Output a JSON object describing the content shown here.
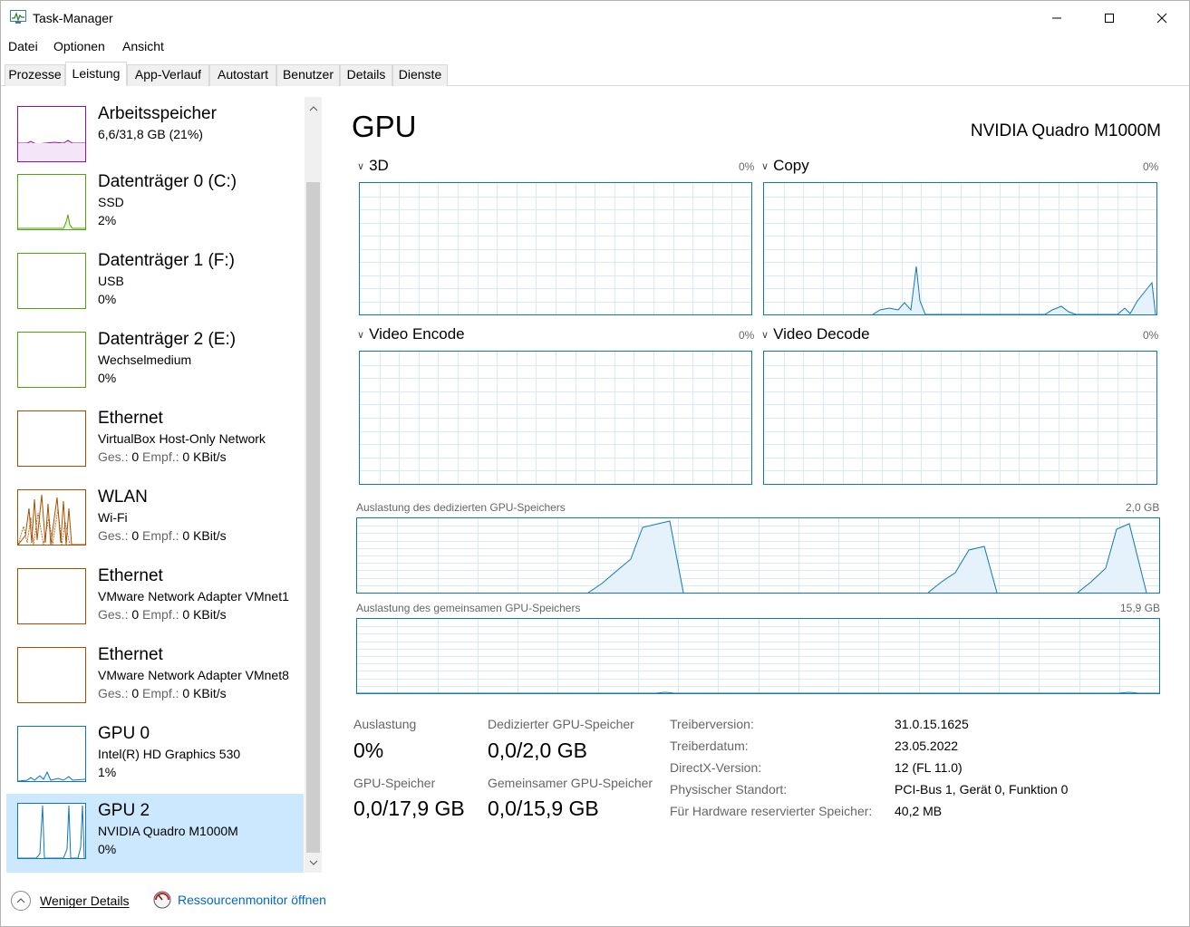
{
  "window": {
    "title": "Task-Manager",
    "minimize": "—",
    "maximize": "☐",
    "close": "✕"
  },
  "menu": [
    "Datei",
    "Optionen",
    "Ansicht"
  ],
  "tabs": [
    "Prozesse",
    "Leistung",
    "App-Verlauf",
    "Autostart",
    "Benutzer",
    "Details",
    "Dienste"
  ],
  "active_tab": "Leistung",
  "sidebar": {
    "items": [
      {
        "title": "Arbeitsspeicher",
        "sub": "6,6/31,8 GB (21%)",
        "val": "",
        "color": "#8b12ae"
      },
      {
        "title": "Datenträger 0 (C:)",
        "sub": "SSD",
        "val": "2%",
        "color": "#4da60c"
      },
      {
        "title": "Datenträger 1 (F:)",
        "sub": "USB",
        "val": "0%",
        "color": "#4da60c"
      },
      {
        "title": "Datenträger 2 (E:)",
        "sub": "Wechselmedium",
        "val": "0%",
        "color": "#4da60c"
      },
      {
        "title": "Ethernet",
        "sub": "VirtualBox Host-Only Network",
        "val_ges": "Ges.:",
        "val_ges_v": "0",
        "val_empf": "Empf.:",
        "val_empf_v": "0 KBit/s",
        "color": "#a74f01"
      },
      {
        "title": "WLAN",
        "sub": "Wi-Fi",
        "val_ges": "Ges.:",
        "val_ges_v": "0",
        "val_empf": "Empf.:",
        "val_empf_v": "0 KBit/s",
        "color": "#a74f01"
      },
      {
        "title": "Ethernet",
        "sub": "VMware Network Adapter VMnet1",
        "val_ges": "Ges.:",
        "val_ges_v": "0",
        "val_empf": "Empf.:",
        "val_empf_v": "0 KBit/s",
        "color": "#a74f01"
      },
      {
        "title": "Ethernet",
        "sub": "VMware Network Adapter VMnet8",
        "val_ges": "Ges.:",
        "val_ges_v": "0",
        "val_empf": "Empf.:",
        "val_empf_v": "0 KBit/s",
        "color": "#a74f01"
      },
      {
        "title": "GPU 0",
        "sub": "Intel(R) HD Graphics 530",
        "val": "1%",
        "color": "#1177bb"
      },
      {
        "title": "GPU 2",
        "sub": "NVIDIA Quadro M1000M",
        "val": "0%",
        "color": "#1177bb"
      }
    ]
  },
  "main": {
    "title": "GPU",
    "model": "NVIDIA Quadro M1000M",
    "engines": [
      {
        "label": "3D",
        "pct": "0%"
      },
      {
        "label": "Copy",
        "pct": "0%"
      },
      {
        "label": "Video Encode",
        "pct": "0%"
      },
      {
        "label": "Video Decode",
        "pct": "0%"
      }
    ],
    "dedicated_label": "Auslastung des dedizierten GPU-Speichers",
    "dedicated_max": "2,0 GB",
    "shared_label": "Auslastung des gemeinsamen GPU-Speichers",
    "shared_max": "15,9 GB",
    "stats": {
      "auslastung_label": "Auslastung",
      "auslastung_value": "0%",
      "dediziert_label": "Dedizierter GPU-Speicher",
      "dediziert_value": "0,0/2,0 GB",
      "gpuspeicher_label": "GPU-Speicher",
      "gpuspeicher_value": "0,0/17,9 GB",
      "gemeinsam_label": "Gemeinsamer GPU-Speicher",
      "gemeinsam_value": "0,0/15,9 GB"
    },
    "info": [
      {
        "key": "Treiberversion:",
        "value": "31.0.15.1625"
      },
      {
        "key": "Treiberdatum:",
        "value": "23.05.2022"
      },
      {
        "key": "DirectX-Version:",
        "value": "12 (FL 11.0)"
      },
      {
        "key": "Physischer Standort:",
        "value": "PCI-Bus 1, Gerät 0, Funktion 0"
      },
      {
        "key": "Für Hardware reservierter Speicher:",
        "value": "40,2 MB"
      }
    ]
  },
  "footer": {
    "less_details": "Weniger Details",
    "resource_monitor": "Ressourcenmonitor öffnen"
  },
  "colors": {
    "gpu": "#1177bb",
    "selected": "#cce8ff"
  }
}
